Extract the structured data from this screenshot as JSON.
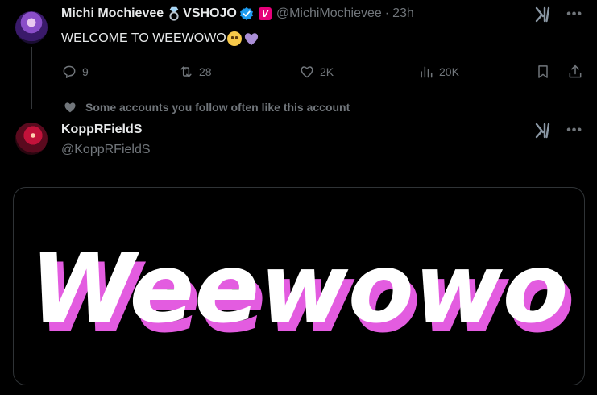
{
  "post1": {
    "display_name": "Michi Mochievee",
    "ring_icon": "ring-icon",
    "affiliation": "VSHOJO",
    "verified_icon": "verified-badge-icon",
    "affiliation_badge": "V",
    "handle": "@MichiMochievee",
    "separator": "·",
    "time": "23h",
    "text": "WELCOME TO WEEWOWO",
    "emojis": [
      "pleading-face-emoji",
      "purple-heart-emoji"
    ],
    "actions": {
      "replies": "9",
      "reposts": "28",
      "likes": "2K",
      "views": "20K"
    },
    "more_label": "•••"
  },
  "social_context": {
    "text": "Some accounts you follow often like this account"
  },
  "post2": {
    "display_name": "KoppRFieldS",
    "handle": "@KoppRFieldS",
    "more_label": "•••",
    "media": {
      "logo_text": "Weewowo",
      "colors": {
        "fill": "#ffffff",
        "shadow": "#e35ce0",
        "background": "#000000"
      }
    }
  },
  "colors": {
    "background": "#000000",
    "text_primary": "#e7e9ea",
    "text_secondary": "#71767b",
    "verified_blue": "#1d9bf0",
    "vshojo_pink": "#e6007a"
  }
}
